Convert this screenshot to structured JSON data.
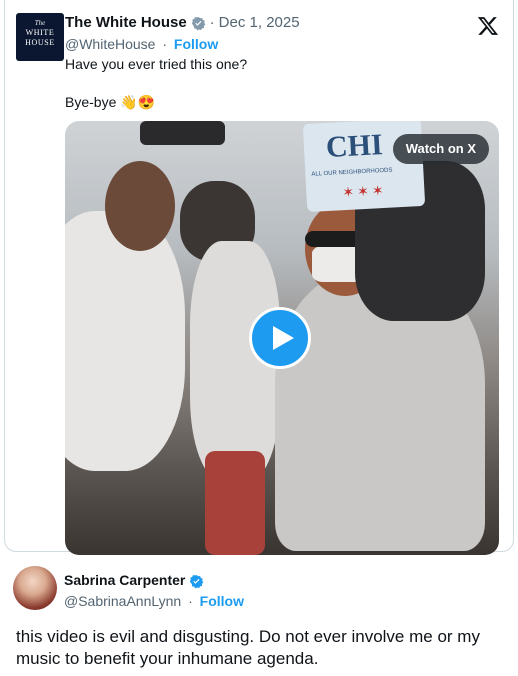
{
  "post": {
    "author_name": "The White House",
    "author_handle": "@WhiteHouse",
    "follow_label": "Follow",
    "date": "Dec 1, 2025",
    "date_separator": "·",
    "handle_separator": "·",
    "logo": {
      "seal": "The",
      "line1": "WHITE",
      "line2": "HOUSE"
    },
    "text_line1": "Have you ever tried this one?",
    "text_line2": "Bye-bye",
    "text_emojis": "👋😍",
    "video": {
      "watch_label": "Watch on X",
      "sign_text": "CHI",
      "sign_subtext": "ALL OUR NEIGHBORHOODS"
    }
  },
  "reply": {
    "author_name": "Sabrina Carpenter",
    "author_handle": "@SabrinaAnnLynn",
    "follow_label": "Follow",
    "handle_separator": "·",
    "text": "this video is evil and disgusting. Do not ever involve me or my music to benefit your inhumane agenda."
  },
  "colors": {
    "accent": "#1d9bf0",
    "verified_badge": "#1d9bf0",
    "secondary_text": "#536471",
    "primary_text": "#0f1419",
    "logo_background": "#0b1730"
  },
  "icons": {
    "verified": "verified-badge-icon",
    "x": "x-logo-icon",
    "play": "play-icon"
  }
}
